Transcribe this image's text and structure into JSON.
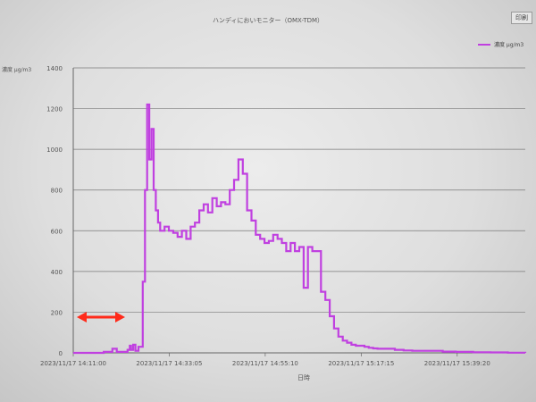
{
  "window": {
    "title": "ハンディにおいモニター（OMX-TDM）",
    "print_label": "印刷"
  },
  "chart_data": {
    "type": "line",
    "title": "ハンディにおいモニター（OMX-TDM）",
    "xlabel": "日時",
    "ylabel": "濃度 μg/m3",
    "ylim": [
      0,
      1400
    ],
    "yticks": [
      0,
      200,
      400,
      600,
      800,
      1000,
      1200,
      1400
    ],
    "xtick_labels": [
      "2023/11/17 14:11:00",
      "2023/11/17 14:33:05",
      "2023/11/17 14:55:10",
      "2023/11/17 15:17:15",
      "2023/11/17 15:39:20"
    ],
    "x_minutes_range": [
      0,
      104
    ],
    "grid": true,
    "legend_position": "top-right",
    "series": [
      {
        "name": "濃度 μg/m3",
        "color": "#c040e0",
        "x_minutes": [
          0,
          7,
          8,
          9,
          10,
          12,
          12.5,
          13,
          13.3,
          13.8,
          14.3,
          15,
          16,
          16.5,
          17,
          17.5,
          18,
          18.5,
          19,
          19.5,
          20,
          21,
          22,
          23,
          24,
          25,
          26,
          27,
          28,
          29,
          30,
          31,
          32,
          33,
          34,
          35,
          36,
          37,
          38,
          39,
          40,
          41,
          42,
          43,
          44,
          45,
          46,
          47,
          48,
          49,
          50,
          51,
          52,
          53,
          54,
          55,
          56,
          57,
          58,
          59,
          60,
          61,
          62,
          63,
          64,
          65,
          66,
          67,
          68,
          69,
          70,
          72,
          74,
          76,
          78,
          80,
          85,
          88,
          92,
          96,
          100,
          104
        ],
        "values": [
          0,
          5,
          5,
          20,
          5,
          5,
          15,
          35,
          15,
          40,
          10,
          30,
          350,
          800,
          1220,
          950,
          1100,
          800,
          700,
          640,
          600,
          620,
          600,
          590,
          570,
          600,
          560,
          620,
          640,
          700,
          730,
          690,
          760,
          720,
          740,
          730,
          800,
          850,
          950,
          880,
          700,
          650,
          580,
          560,
          540,
          550,
          580,
          560,
          540,
          500,
          540,
          500,
          520,
          320,
          520,
          500,
          500,
          300,
          260,
          180,
          120,
          80,
          60,
          50,
          40,
          35,
          35,
          30,
          25,
          22,
          20,
          20,
          15,
          12,
          10,
          10,
          6,
          5,
          3,
          2,
          1,
          0
        ]
      }
    ]
  },
  "annotation": {
    "arrow_color": "#ff2a1a"
  }
}
